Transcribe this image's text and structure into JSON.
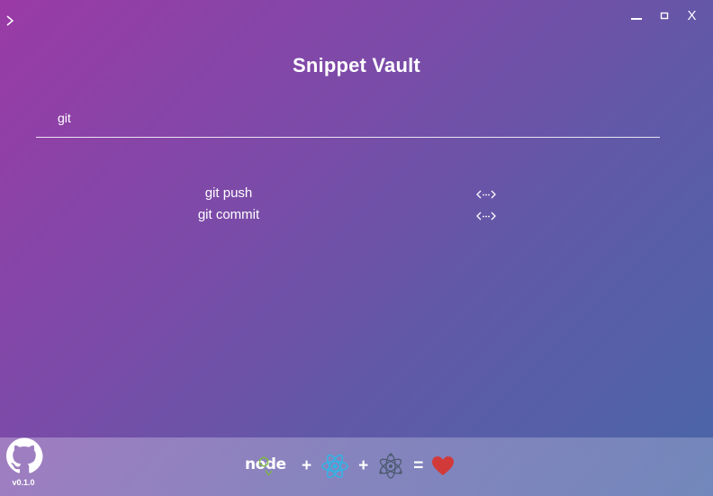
{
  "window": {
    "expand_glyph": "›",
    "minimize_icon": "minimize-icon",
    "maximize_icon": "maximize-icon",
    "close_label": "X"
  },
  "app": {
    "title": "Snippet Vault"
  },
  "search": {
    "value": "git"
  },
  "results": [
    {
      "name": "git push",
      "icon": "code-icon"
    },
    {
      "name": "git commit",
      "icon": "code-icon"
    }
  ],
  "footer": {
    "version": "v0.1.0",
    "node_label": "node",
    "plus": "+",
    "equals": "=",
    "icons": [
      "github-icon",
      "node-icon",
      "react-icon",
      "electron-icon",
      "heart-icon"
    ],
    "colors": {
      "react": "#2fb6e6",
      "electron": "#4b5a6e",
      "heart": "#d23a3a",
      "node_green": "#7ebd3c"
    }
  },
  "colors": {
    "gradient_start": "#9a3aa6",
    "gradient_end": "#4a66a8",
    "text": "#ffffff"
  }
}
